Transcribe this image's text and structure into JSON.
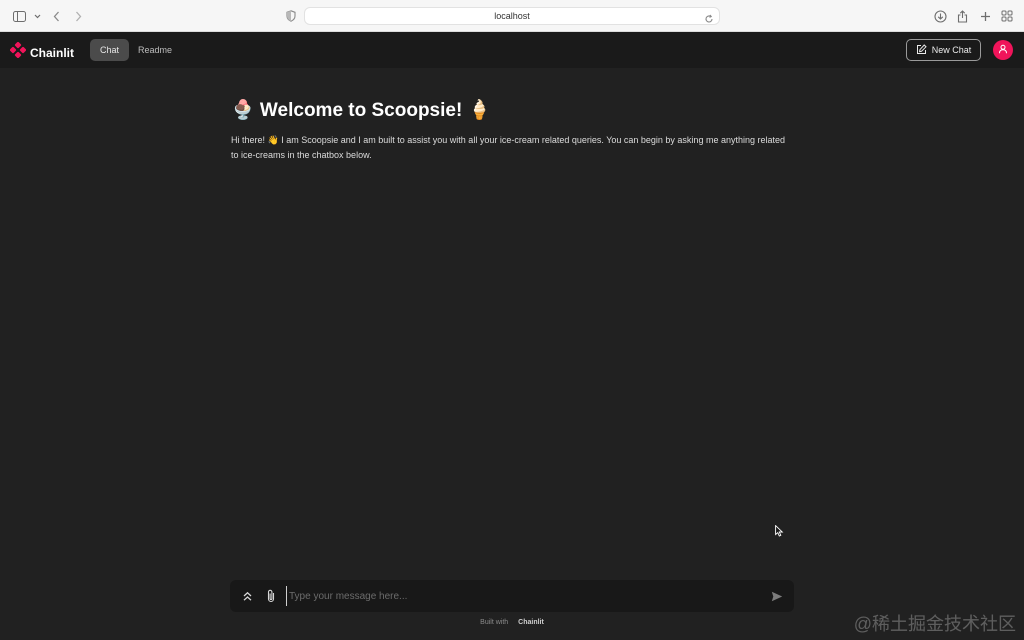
{
  "browser": {
    "url": "localhost",
    "icons": [
      "sidebar-icon",
      "chevron-down-icon",
      "back-icon",
      "forward-icon",
      "shield-icon",
      "reload-icon",
      "download-icon",
      "share-icon",
      "plus-icon",
      "tabs-grid-icon"
    ]
  },
  "header": {
    "brand": "Chainlit",
    "tabs": [
      {
        "label": "Chat",
        "active": true
      },
      {
        "label": "Readme",
        "active": false
      }
    ],
    "new_chat_label": "New Chat",
    "accent_color": "#f0145a"
  },
  "main": {
    "title": "🍨 Welcome to Scoopsie! 🍦",
    "message": "Hi there! 👋 I am Scoopsie and I am built to assist you with all your ice-cream related queries. You can begin by asking me anything related to ice-creams in the chatbox below."
  },
  "composer": {
    "placeholder": "Type your message here...",
    "icons": [
      "chevrons-up-icon",
      "paperclip-icon",
      "send-icon"
    ]
  },
  "footer": {
    "built_with": "Built with",
    "brand": "Chainlit"
  },
  "watermark": "@稀土掘金技术社区"
}
